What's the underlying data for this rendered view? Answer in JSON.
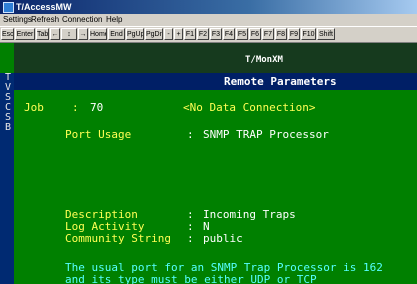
{
  "window": {
    "title": "T/AccessMW"
  },
  "menu": [
    "Settings",
    "Refresh",
    "Connection",
    "Help"
  ],
  "toolbar": [
    "Esc",
    "Enter",
    "Tab",
    "←",
    "↕",
    "→",
    "Home",
    "End",
    "PgUp",
    "PgDn",
    "-",
    "+",
    "F1",
    "F2",
    "F3",
    "F4",
    "F5",
    "F6",
    "F7",
    "F8",
    "F9",
    "F10",
    "Shift"
  ],
  "terminal": {
    "program_title": "T/MonXM",
    "sidebar_text": "T\nV\nS\nC\nS\nB",
    "header": "Remote Parameters",
    "job_label": "Job",
    "job_sep": ":",
    "job_value": "70",
    "connection_status": "<No Data Connection>",
    "port_usage_label": "Port Usage",
    "port_usage_sep": ":",
    "port_usage_value": "SNMP TRAP Processor",
    "description_label": "Description",
    "description_sep": ":",
    "description_value": "Incoming Traps",
    "log_activity_label": "Log Activity",
    "log_activity_sep": ":",
    "log_activity_value": "N",
    "community_label": "Community String",
    "community_sep": ":",
    "community_value": "public",
    "help_line1": "The usual port for an SNMP Trap Processor is 162",
    "help_line2": "and its type must be either UDP or TCP"
  }
}
